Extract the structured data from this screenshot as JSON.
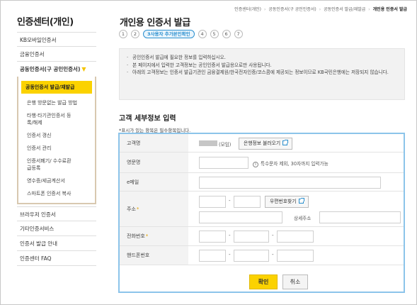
{
  "sidebar": {
    "title": "인증센터(개인)",
    "items": [
      {
        "label": "KB모바일인증서"
      },
      {
        "label": "금융인증서"
      },
      {
        "label": "공동인증서(구 공인인증서)"
      }
    ],
    "sub_items": [
      {
        "label": "공동인증서 발급/재발급"
      },
      {
        "label": "은행 방문없는 발급 방법"
      },
      {
        "label": "타행·타기관인증서 등록/해제"
      },
      {
        "label": "인증서 갱신"
      },
      {
        "label": "인증서 관리"
      },
      {
        "label": "인증서폐기/ 수수료환급등록"
      },
      {
        "label": "영수증/세금계산서"
      },
      {
        "label": "스마트폰 인증서 복사"
      }
    ],
    "bottom_items": [
      {
        "label": "브라우저 인증서"
      },
      {
        "label": "기타인증서비스"
      },
      {
        "label": "인증서 발급 안내"
      },
      {
        "label": "인증센터 FAQ"
      }
    ]
  },
  "breadcrumb": [
    "인증센터(개인)",
    "공동인증서(구 공인인증서)",
    "공동인증서 발급/재발급",
    "개인용 인증서 발급"
  ],
  "page_title": "개인용 인증서 발급",
  "steps": [
    "1",
    "2",
    "3사용자 추가본인확인",
    "4",
    "5",
    "6",
    "7"
  ],
  "notice": [
    "공인인증서 발급에 필요한 정보를 입력하십시오.",
    "본 페이지에서 입력한 고객정보는 공인인증서 발급용으로만 사용됩니다.",
    "아래의 고객정보는 인증서 발급기관인 금융결제원/한국전자인증/코스콤에 제공되는 정보이므로 KB국민은행에는 저장되지 않습니다."
  ],
  "section_title": "고객 세부정보 입력",
  "required_note": "*표시가 있는 항목은 필수항목입니다.",
  "form": {
    "name_label": "고객명",
    "name_mask": "(모임)",
    "load_bank_info_button": "은행정보 불러오기",
    "english_name_label": "영문명",
    "english_hint": "특수문자 제외, 30자까지 입력가능",
    "email_label": "e메일",
    "address_label": "주소",
    "zip_search_button": "우편번호찾기",
    "detail_address_label": "상세주소",
    "phone_label": "전화번호",
    "mobile_label": "핸드폰번호",
    "dash": "-",
    "star": "*"
  },
  "buttons": {
    "confirm": "확인",
    "cancel": "취소"
  },
  "colors": {
    "accent": "#fbd200",
    "form_border": "#8cc4ea",
    "step_active": "#2a8fcf"
  }
}
